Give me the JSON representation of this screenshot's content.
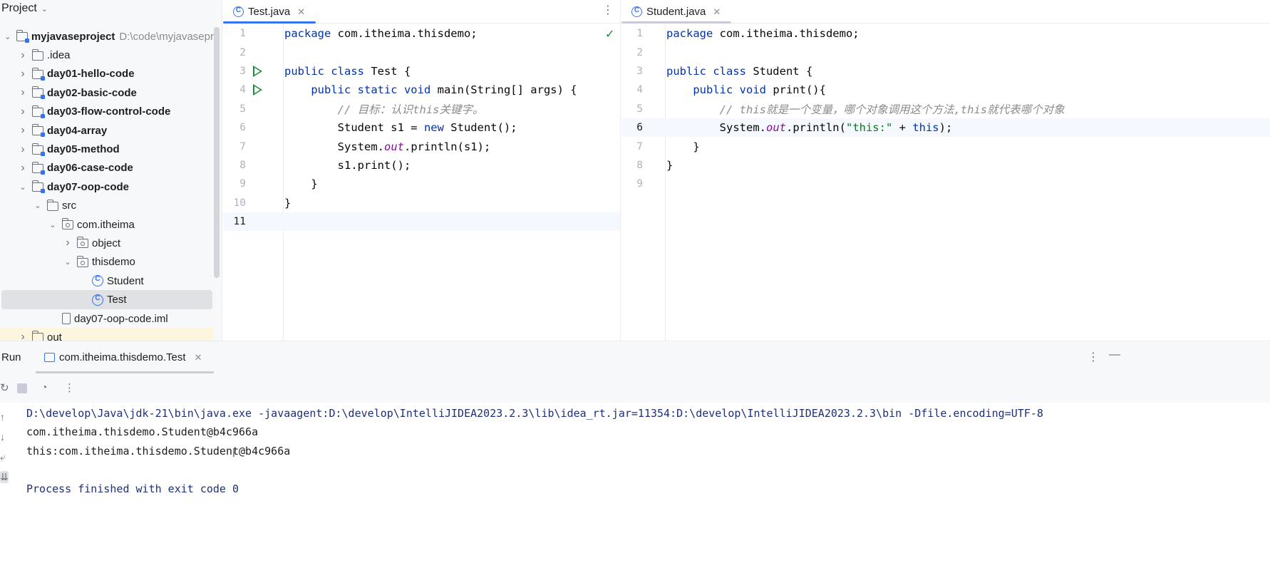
{
  "project": {
    "title": "Project",
    "tree": [
      {
        "label": "myjavaseproject",
        "path": "D:\\code\\myjavasepr",
        "level": 0,
        "arrow": "down",
        "icon": "module"
      },
      {
        "label": ".idea",
        "level": 1,
        "arrow": "right",
        "icon": "folder"
      },
      {
        "label": "day01-hello-code",
        "level": 1,
        "arrow": "right",
        "icon": "module"
      },
      {
        "label": "day02-basic-code",
        "level": 1,
        "arrow": "right",
        "icon": "module"
      },
      {
        "label": "day03-flow-control-code",
        "level": 1,
        "arrow": "right",
        "icon": "module"
      },
      {
        "label": "day04-array",
        "level": 1,
        "arrow": "right",
        "icon": "module"
      },
      {
        "label": "day05-method",
        "level": 1,
        "arrow": "right",
        "icon": "module"
      },
      {
        "label": "day06-case-code",
        "level": 1,
        "arrow": "right",
        "icon": "module"
      },
      {
        "label": "day07-oop-code",
        "level": 1,
        "arrow": "down",
        "icon": "module"
      },
      {
        "label": "src",
        "level": 2,
        "arrow": "down",
        "icon": "folder"
      },
      {
        "label": "com.itheima",
        "level": 3,
        "arrow": "down",
        "icon": "package"
      },
      {
        "label": "object",
        "level": 4,
        "arrow": "right",
        "icon": "package"
      },
      {
        "label": "thisdemo",
        "level": 4,
        "arrow": "down",
        "icon": "package"
      },
      {
        "label": "Student",
        "level": 5,
        "arrow": "none",
        "icon": "class"
      },
      {
        "label": "Test",
        "level": 5,
        "arrow": "none",
        "icon": "class",
        "selected": true
      },
      {
        "label": "day07-oop-code.iml",
        "level": 3,
        "arrow": "none",
        "icon": "file"
      },
      {
        "label": "out",
        "level": 1,
        "arrow": "right",
        "icon": "folder",
        "excluded": true
      }
    ]
  },
  "editor_left": {
    "tab_label": "Test.java",
    "lines": [
      {
        "n": "1",
        "html": "<span class=\"kw\">package</span> com.itheima.thisdemo;"
      },
      {
        "n": "2",
        "html": ""
      },
      {
        "n": "3",
        "html": "<span class=\"kw\">public class</span> Test {",
        "run": true
      },
      {
        "n": "4",
        "html": "    <span class=\"kw\">public static void</span> main(String[] args) {",
        "run": true
      },
      {
        "n": "5",
        "html": "        <span class=\"cmt\">// 目标：认识this关键字。</span>"
      },
      {
        "n": "6",
        "html": "        Student s1 = <span class=\"kw\">new</span> Student();"
      },
      {
        "n": "7",
        "html": "        System.<span class=\"fld\">out</span>.println(s1);"
      },
      {
        "n": "8",
        "html": "        s1.print();"
      },
      {
        "n": "9",
        "html": "    }"
      },
      {
        "n": "10",
        "html": "}"
      },
      {
        "n": "11",
        "html": "",
        "current": true
      }
    ]
  },
  "editor_right": {
    "tab_label": "Student.java",
    "lines": [
      {
        "n": "1",
        "html": "<span class=\"kw\">package</span> com.itheima.thisdemo;"
      },
      {
        "n": "2",
        "html": ""
      },
      {
        "n": "3",
        "html": "<span class=\"kw\">public class</span> Student {"
      },
      {
        "n": "4",
        "html": "    <span class=\"kw\">public void</span> print(){"
      },
      {
        "n": "5",
        "html": "        <span class=\"cmt\">// this就是一个变量，哪个对象调用这个方法,this就代表哪个对象</span>"
      },
      {
        "n": "6",
        "html": "        System.<span class=\"fld\">out</span>.println(<span class=\"str\">\"this:\"</span> + <span class=\"kw\">this</span>);",
        "current": true
      },
      {
        "n": "7",
        "html": "    }"
      },
      {
        "n": "8",
        "html": "}"
      },
      {
        "n": "9",
        "html": ""
      }
    ]
  },
  "run": {
    "title": "Run",
    "tab_label": "com.itheima.thisdemo.Test",
    "console": [
      "D:\\develop\\Java\\jdk-21\\bin\\java.exe -javaagent:D:\\develop\\IntelliJIDEA2023.2.3\\lib\\idea_rt.jar=11354:D:\\develop\\IntelliJIDEA2023.2.3\\bin -Dfile.encoding=UTF-8",
      "com.itheima.thisdemo.Student@b4c966a",
      "this:com.itheima.thisdemo.Student@b4c966a",
      "",
      "Process finished with exit code 0"
    ]
  },
  "icons": {
    "chevron_down": "⌄",
    "chevron_right": "›",
    "close": "✕",
    "more": "⋮",
    "check": "✓",
    "rerun": "↻",
    "up": "↑",
    "down": "↓",
    "wrap": "⤶",
    "scroll_end": "⇊",
    "minimize": "—",
    "ibeam": "I"
  },
  "colors": {
    "accent": "#3574f0",
    "keyword": "#0033b3",
    "string": "#067d17",
    "comment": "#8c8c8c",
    "field": "#871094",
    "run_green": "#208a3c"
  }
}
